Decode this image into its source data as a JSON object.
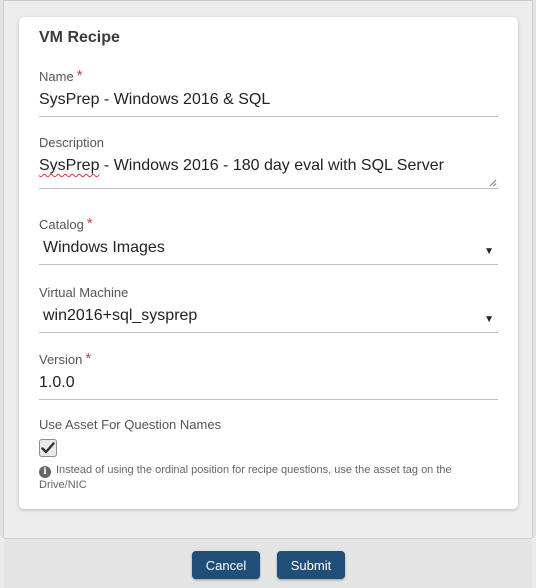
{
  "form": {
    "title": "VM Recipe",
    "name": {
      "label": "Name",
      "required_mark": "*",
      "value": "SysPrep - Windows 2016 & SQL"
    },
    "description": {
      "label": "Description",
      "value_misspelled": "SysPrep",
      "value_rest": " - Windows 2016 - 180 day eval with SQL Server"
    },
    "catalog": {
      "label": "Catalog",
      "required_mark": "*",
      "selected": "Windows Images",
      "caret": "▼"
    },
    "virtual_machine": {
      "label": "Virtual Machine",
      "selected": "win2016+sql_sysprep",
      "caret": "▼"
    },
    "version": {
      "label": "Version",
      "required_mark": "*",
      "value": "1.0.0"
    },
    "use_asset": {
      "label": "Use Asset For Question Names",
      "checked": true,
      "info_icon": "i",
      "help_text": "Instead of using the ordinal position for recipe questions, use the asset tag on the Drive/NIC"
    }
  },
  "footer": {
    "cancel_label": "Cancel",
    "submit_label": "Submit"
  },
  "colors": {
    "button": "#1f4e79",
    "required": "#b94a48"
  }
}
